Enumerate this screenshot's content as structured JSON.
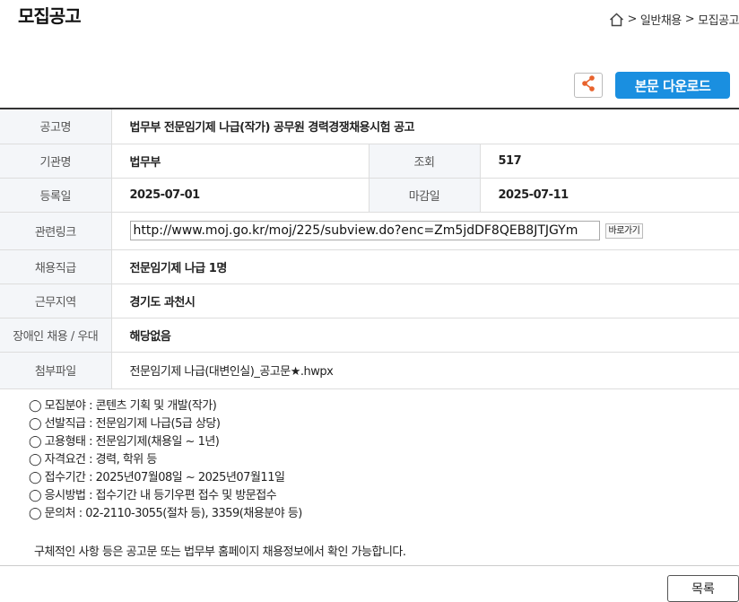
{
  "page": {
    "title": "모집공고"
  },
  "breadcrumb": {
    "sep1": ">",
    "item1": "일반채용",
    "sep2": ">",
    "item2": "모집공고"
  },
  "actions": {
    "download_label": "본문 다운로드"
  },
  "info": {
    "title_label": "공고명",
    "title_value": "법무부 전문임기제 나급(작가) 공무원 경력경쟁채용시험 공고",
    "agency_label": "기관명",
    "agency_value": "법무부",
    "views_label": "조회",
    "views_value": "517",
    "reg_label": "등록일",
    "reg_value": "2025-07-01",
    "deadline_label": "마감일",
    "deadline_value": "2025-07-11",
    "link_label": "관련링크",
    "link_value": "http://www.moj.go.kr/moj/225/subview.do?enc=Zm5jdDF8QEB8JTJGYm",
    "link_button": "바로가기",
    "position_label": "채용직급",
    "position_value": "전문임기제 나급 1명",
    "region_label": "근무지역",
    "region_value": "경기도 과천시",
    "disability_label": "장애인 채용 / 우대",
    "disability_value": "해당없음",
    "attach_label": "첨부파일",
    "attach_value": "전문임기제 나급(대변인실)_공고문★.hwpx"
  },
  "description": [
    "◯ 모집분야 : 콘텐츠 기획 및 개발(작가)",
    "◯ 선발직급 : 전문임기제 나급(5급 상당)",
    "◯ 고용형태 : 전문임기제(채용일 ~ 1년)",
    "◯ 자격요건 : 경력, 학위 등",
    "◯ 접수기간 : 2025년07월08일 ~ 2025년07월11일",
    "◯ 응시방법 : 접수기간 내 등기우편 접수 및 방문접수",
    "◯ 문의처 : 02-2110-3055(절차 등), 3359(채용분야 등)"
  ],
  "note": "구체적인 사항 등은 공고문 또는 법무부 홈페이지 채용정보에서 확인 가능합니다.",
  "footer": {
    "list_button": "목록"
  },
  "colors": {
    "accent": "#1a8fe0",
    "share_icon": "#e8622c",
    "header_bg": "#f4f6f9"
  },
  "icons": {
    "home": "home-icon",
    "share": "share-icon"
  }
}
